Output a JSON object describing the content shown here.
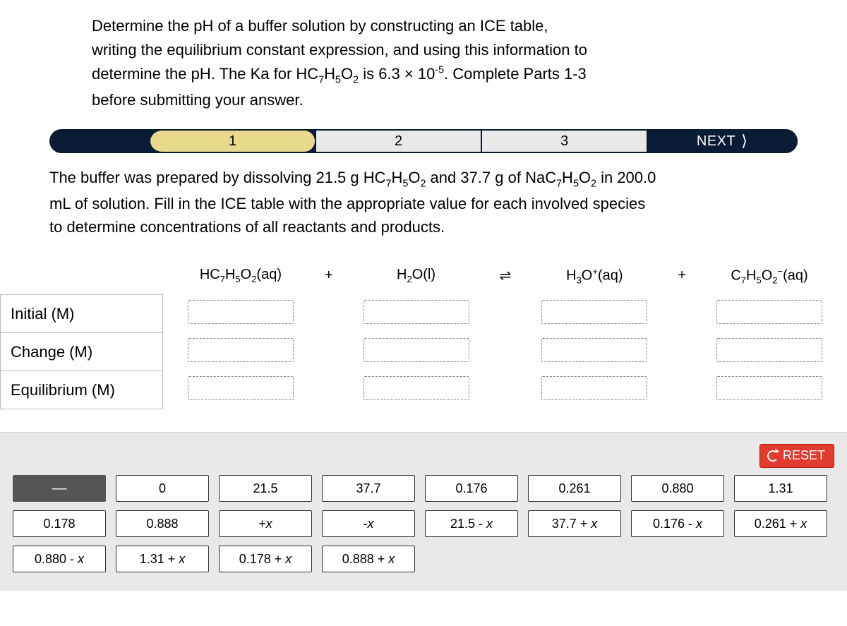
{
  "intro_line1": "Determine the pH of a buffer solution by constructing an ICE table,",
  "intro_line2": "writing the equilibrium constant expression, and using this information to",
  "intro_line3_a": "determine the pH. The Ka for HC",
  "intro_line3_b": " is 6.3 × 10",
  "intro_line3_c": ". Complete Parts 1-3",
  "intro_line4": "before submitting your answer.",
  "stepper": {
    "steps": [
      "1",
      "2",
      "3"
    ],
    "next": "NEXT"
  },
  "prompt_a": "The buffer was prepared by dissolving 21.5 g HC",
  "prompt_b": " and 37.7 g of NaC",
  "prompt_c": " in 200.0",
  "prompt_line2": "mL of solution. Fill in the ICE table with the appropriate value for each involved species",
  "prompt_line3": "to determine concentrations of all reactants and products.",
  "species": {
    "acid": "HC₇H₅O₂(aq)",
    "water": "H₂O(l)",
    "hydronium": "H₃O⁺(aq)",
    "base": "C₇H₅O₂⁻(aq)"
  },
  "rows": {
    "initial": "Initial (M)",
    "change": "Change (M)",
    "equilibrium": "Equilibrium (M)"
  },
  "reset": "RESET",
  "tiles": [
    "—",
    "0",
    "21.5",
    "37.7",
    "0.176",
    "0.261",
    "0.880",
    "1.31",
    "0.178",
    "0.888",
    "+x",
    "-x",
    "21.5 - x",
    "37.7 + x",
    "0.176 - x",
    "0.261 + x",
    "0.880 - x",
    "1.31 + x",
    "0.178 + x",
    "0.888 + x"
  ]
}
